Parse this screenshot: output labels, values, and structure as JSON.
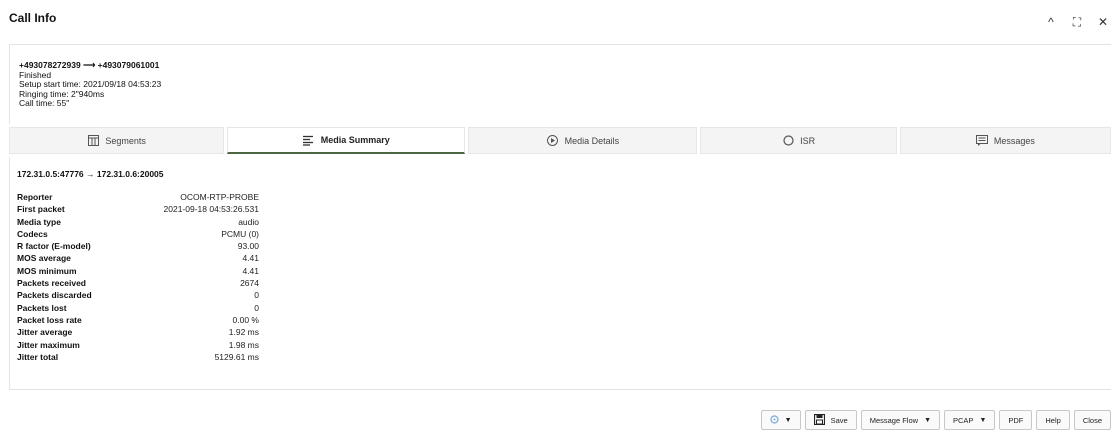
{
  "window": {
    "title": "Call Info",
    "controls": {
      "collapse": "^",
      "fullscreen": "⛶",
      "close": "✕"
    }
  },
  "call": {
    "from": "+493078272939",
    "arrow": "⟶",
    "to": "+493079061001",
    "status": "Finished",
    "setup_start": "Setup start time: 2021/09/18 04:53:23",
    "ringing_time": "Ringing time: 2\"940ms",
    "call_time": "Call time: 55\""
  },
  "tabs": [
    {
      "label": "Segments",
      "icon": "segments-icon",
      "active": false
    },
    {
      "label": "Media Summary",
      "icon": "list-icon",
      "active": true
    },
    {
      "label": "Media Details",
      "icon": "play-circle-icon",
      "active": false
    },
    {
      "label": "ISR",
      "icon": "circle-icon",
      "active": false
    },
    {
      "label": "Messages",
      "icon": "message-icon",
      "active": false
    }
  ],
  "media": {
    "stream": "172.31.0.5:47776 → 172.31.0.6:20005",
    "rows": [
      {
        "key": "Reporter",
        "value": "OCOM-RTP-PROBE"
      },
      {
        "key": "First packet",
        "value": "2021-09-18 04:53:26.531"
      },
      {
        "key": "Media type",
        "value": "audio"
      },
      {
        "key": "Codecs",
        "value": "PCMU (0)"
      },
      {
        "key": "R factor (E-model)",
        "value": "93.00"
      },
      {
        "key": "MOS average",
        "value": "4.41"
      },
      {
        "key": "MOS minimum",
        "value": "4.41"
      },
      {
        "key": "Packets received",
        "value": "2674"
      },
      {
        "key": "Packets discarded",
        "value": "0"
      },
      {
        "key": "Packets lost",
        "value": "0"
      },
      {
        "key": "Packet loss rate",
        "value": "0.00 %"
      },
      {
        "key": "Jitter average",
        "value": "1.92 ms"
      },
      {
        "key": "Jitter maximum",
        "value": "1.98 ms"
      },
      {
        "key": "Jitter total",
        "value": "5129.61 ms"
      }
    ]
  },
  "buttons": {
    "save": "Save",
    "message_flow": "Message Flow",
    "pcap": "PCAP",
    "pdf": "PDF",
    "help": "Help",
    "close": "Close"
  },
  "colors": {
    "active_tab_underline": "#4a6741",
    "border": "#e3e3e3"
  }
}
